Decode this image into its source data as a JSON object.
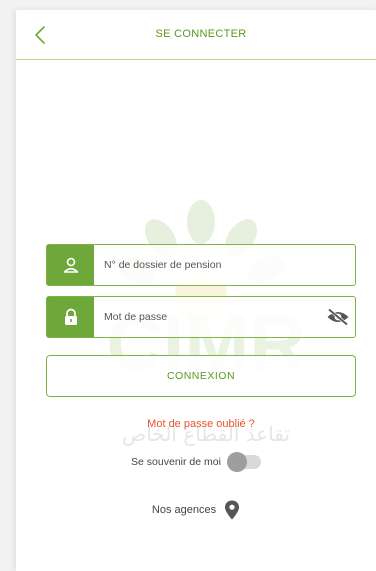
{
  "header": {
    "title": "SE CONNECTER",
    "back_icon": "chevron-left-icon"
  },
  "watermark": {
    "logo_text": "CIMR",
    "arabic_text": "تقاعد القطاع الخاص"
  },
  "login_form": {
    "file_number": {
      "placeholder": "N° de dossier de pension",
      "value": "",
      "icon": "user-icon"
    },
    "password": {
      "placeholder": "Mot de passe",
      "value": "",
      "icon": "lock-icon",
      "visibility_icon": "eye-off-icon"
    },
    "submit_label": "CONNEXION",
    "forgot_label": "Mot de passe oublié ?",
    "remember_label": "Se souvenir de moi",
    "remember_on": false
  },
  "agencies": {
    "label": "Nos agences",
    "icon": "location-pin-icon"
  },
  "colors": {
    "primary_green": "#6ea83a",
    "link_orange": "#e8542a",
    "toggle_off": "#9e9e9e"
  }
}
